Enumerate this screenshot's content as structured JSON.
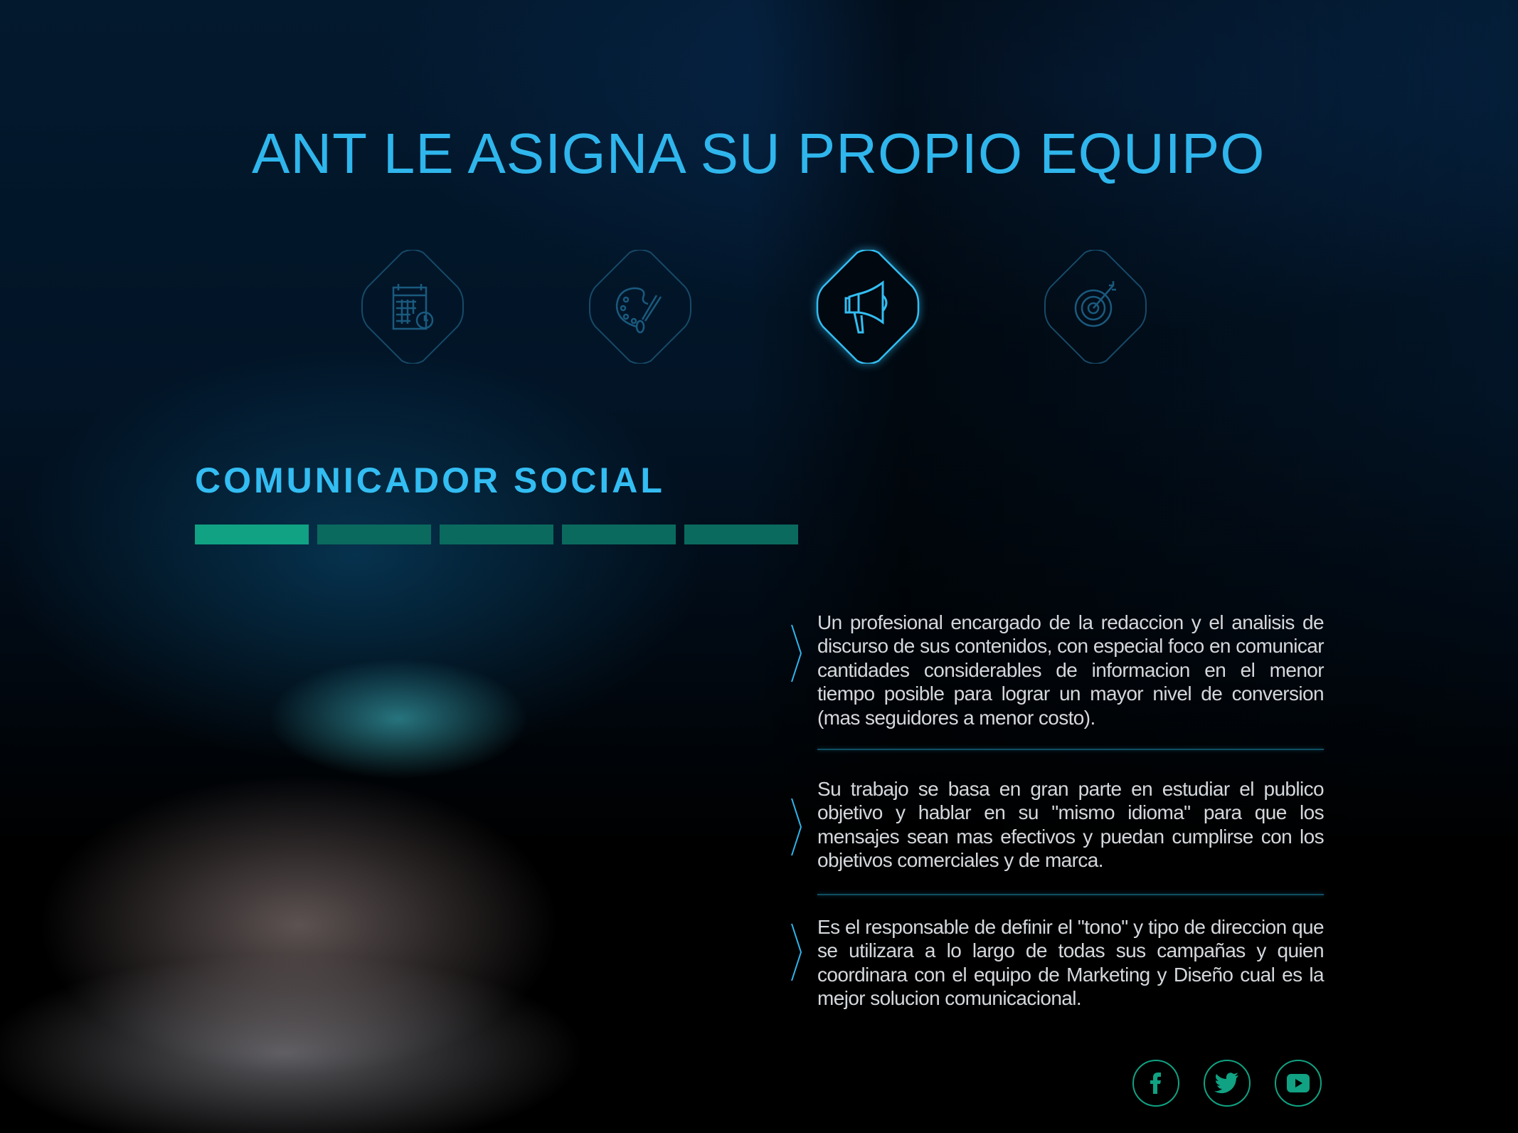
{
  "title": "ANT LE ASIGNA SU PROPIO EQUIPO",
  "team_icons": [
    {
      "icon": "calendar-clock-icon",
      "active": false
    },
    {
      "icon": "palette-brush-icon",
      "active": false
    },
    {
      "icon": "megaphone-icon",
      "active": true
    },
    {
      "icon": "target-arrow-icon",
      "active": false
    }
  ],
  "role": {
    "heading": "COMUNICADOR SOCIAL",
    "progress": {
      "total_segments": 5,
      "active_segment": 1
    }
  },
  "paragraphs": [
    "Un profesional encargado de la redaccion y el analisis de discurso de sus contenidos, con especial foco en comunicar cantidades considerables de informacion en el menor tiempo posible para lograr un mayor nivel de conversion (mas seguidores a menor costo).",
    "Su trabajo se basa en gran parte en estudiar el publico objetivo y hablar en su \"mismo idioma\" para que los mensajes sean mas efectivos y puedan cumplirse con los objetivos comerciales y de marca.",
    "Es el responsable de definir el \"tono\" y tipo de direccion que se utilizara a lo largo de todas sus campañas y quien coordinara con el equipo de Marketing y Diseño cual es la mejor solucion comunicacional."
  ],
  "social": [
    {
      "icon": "facebook-icon"
    },
    {
      "icon": "twitter-icon"
    },
    {
      "icon": "youtube-icon"
    }
  ],
  "colors": {
    "accent": "#2fb6ec",
    "green": "#10a282",
    "icon_dim": "#1a5a7e"
  }
}
